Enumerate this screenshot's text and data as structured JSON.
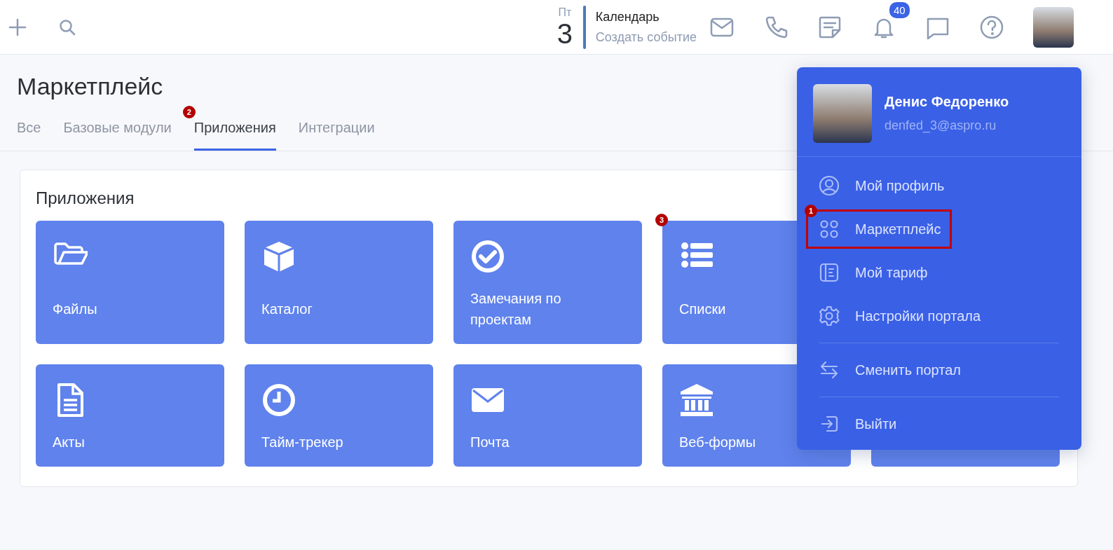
{
  "header": {
    "calendar": {
      "weekday": "Пт",
      "day": "3",
      "title": "Календарь",
      "action": "Создать событие"
    },
    "notifications_badge": "40"
  },
  "page": {
    "title": "Маркетплейс",
    "tabs": [
      {
        "label": "Все",
        "selected": false
      },
      {
        "label": "Базовые модули",
        "selected": false
      },
      {
        "label": "Приложения",
        "selected": true,
        "marker": "2"
      },
      {
        "label": "Интеграции",
        "selected": false
      }
    ]
  },
  "section": {
    "title": "Приложения",
    "tile_rows": [
      [
        {
          "kind": "app",
          "label": "Файлы"
        },
        {
          "kind": "app",
          "label": "Каталог"
        },
        {
          "kind": "app",
          "label": "Замечания по проектам"
        },
        {
          "kind": "app",
          "label": "Списки",
          "marker": "3"
        }
      ],
      [
        {
          "kind": "app",
          "label": "Акты"
        },
        {
          "kind": "app",
          "label": "Тайм-трекер"
        },
        {
          "kind": "app",
          "label": "Почта"
        },
        {
          "kind": "app",
          "label": "Веб-формы"
        },
        {
          "kind": "covered"
        }
      ]
    ]
  },
  "user_menu": {
    "name": "Денис Федоренко",
    "email": "denfed_3@aspro.ru",
    "groups": [
      [
        {
          "label": "Мой профиль",
          "highlighted": false
        },
        {
          "label": "Маркетплейс",
          "highlighted": true,
          "marker": "1"
        },
        {
          "label": "Мой тариф",
          "highlighted": false
        },
        {
          "label": "Настройки портала",
          "highlighted": false
        }
      ],
      [
        {
          "label": "Сменить портал",
          "highlighted": false
        }
      ],
      [
        {
          "label": "Выйти",
          "highlighted": false
        }
      ]
    ]
  }
}
